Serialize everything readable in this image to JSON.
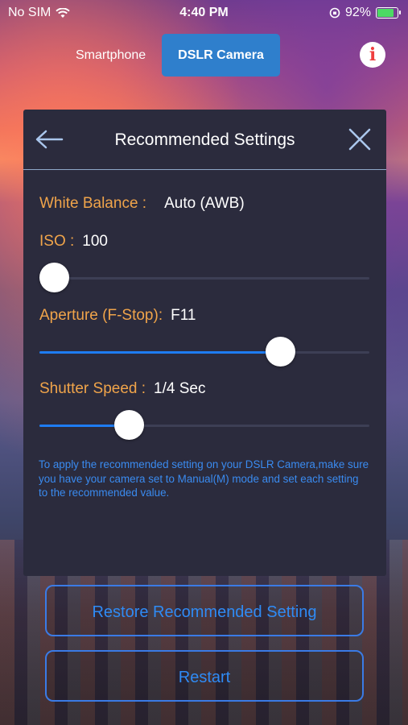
{
  "status_bar": {
    "carrier": "No SIM",
    "time": "4:40 PM",
    "battery": "92%",
    "battery_level": 0.92
  },
  "header": {
    "tabs": [
      {
        "label": "Smartphone",
        "active": false
      },
      {
        "label": "DSLR Camera",
        "active": true
      }
    ],
    "info_label": "i"
  },
  "panel": {
    "title": "Recommended Settings",
    "white_balance": {
      "label": "White Balance :",
      "value": "Auto (AWB)"
    },
    "iso": {
      "label": "ISO :",
      "value": "100",
      "slider_level": 0.03
    },
    "aperture": {
      "label": "Aperture (F-Stop):",
      "value": "F11",
      "slider_level": 0.73
    },
    "shutter": {
      "label": "Shutter Speed :",
      "value": "1/4 Sec",
      "slider_level": 0.27
    },
    "note": "To apply the recommended setting on your DSLR Camera,make sure you have your camera set to Manual(M) mode and set each setting to the recommended value."
  },
  "buttons": {
    "restore": "Restore Recommended Setting",
    "restart": "Restart"
  },
  "colors": {
    "accent": "#2f7fcc",
    "label": "#f0a44a",
    "panel": "#2b2b3d",
    "slider_fill": "#1e7cf2"
  }
}
